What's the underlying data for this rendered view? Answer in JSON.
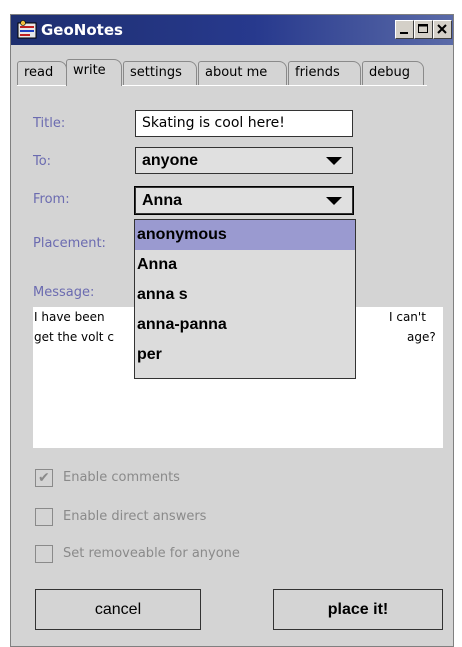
{
  "window": {
    "title": "GeoNotes",
    "controls": {
      "minimize_icon": "minimize-icon",
      "maximize_icon": "maximize-icon",
      "close_icon": "close-icon"
    }
  },
  "tabs": [
    "read",
    "write",
    "settings",
    "about me",
    "friends",
    "debug"
  ],
  "active_tab": "write",
  "form": {
    "title_label": "Title:",
    "title_value": "Skating is cool here!",
    "to_label": "To:",
    "to_value": "anyone",
    "from_label": "From:",
    "from_value": "Anna",
    "placement_label": "Placement:",
    "message_label": "Message:",
    "message_lines": [
      {
        "left": "I have been",
        "right": "I can't"
      },
      {
        "left": "get the volt c",
        "right": "age?"
      }
    ]
  },
  "from_dropdown": {
    "options": [
      "anonymous",
      "Anna",
      "anna s",
      "anna-panna",
      "per"
    ],
    "highlighted": "anonymous"
  },
  "checkboxes": [
    {
      "label": "Enable comments",
      "checked": true
    },
    {
      "label": "Enable direct answers",
      "checked": false
    },
    {
      "label": "Set removeable for anyone",
      "checked": false
    }
  ],
  "buttons": {
    "cancel": "cancel",
    "place": "place it!"
  },
  "colors": {
    "titlebar": "#27398d",
    "panel": "#d4d4d4",
    "label": "#6b6bb0",
    "highlight": "#9a9ad0",
    "disabled_text": "#8a8a8a"
  }
}
